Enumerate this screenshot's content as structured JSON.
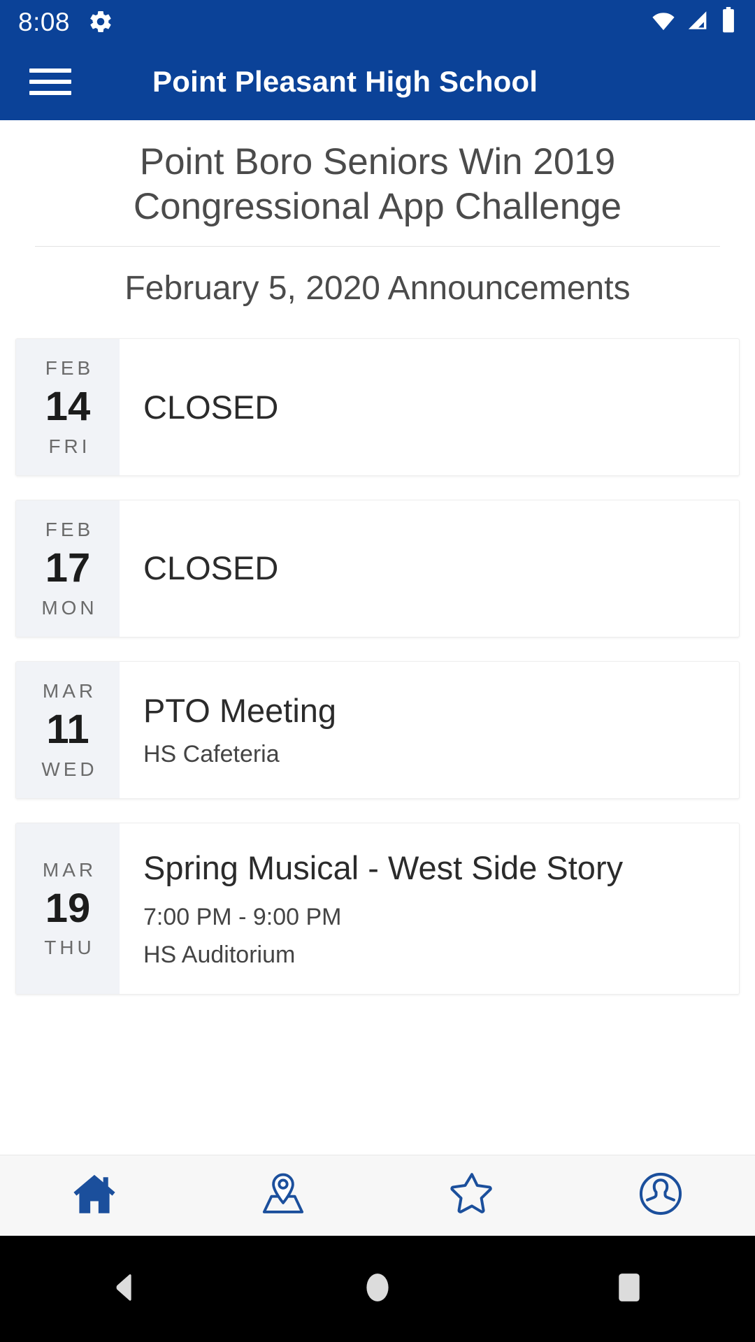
{
  "status_bar": {
    "time": "8:08",
    "icons": [
      "gear-icon",
      "wifi-icon",
      "cellular-signal-icon",
      "battery-icon"
    ]
  },
  "app_bar": {
    "menu_icon": "hamburger-menu-icon",
    "title": "Point Pleasant High School",
    "background_color": "#0b4298"
  },
  "main": {
    "headline": "Point Boro Seniors Win 2019 Congressional App Challenge",
    "section_title": "February 5, 2020 Announcements",
    "events": [
      {
        "month": "FEB",
        "day": "14",
        "weekday": "FRI",
        "title": "CLOSED",
        "time": "",
        "location": ""
      },
      {
        "month": "FEB",
        "day": "17",
        "weekday": "MON",
        "title": "CLOSED",
        "time": "",
        "location": ""
      },
      {
        "month": "MAR",
        "day": "11",
        "weekday": "WED",
        "title": "PTO Meeting",
        "time": "",
        "location": "HS Cafeteria"
      },
      {
        "month": "MAR",
        "day": "19",
        "weekday": "THU",
        "title": "Spring Musical - West Side Story",
        "time": "7:00 PM - 9:00 PM",
        "location": "HS Auditorium"
      }
    ]
  },
  "tab_bar": {
    "accent_color": "#1b4f9c",
    "items": [
      {
        "name": "home",
        "icon": "home-icon",
        "selected": true
      },
      {
        "name": "map",
        "icon": "map-pin-icon",
        "selected": false
      },
      {
        "name": "favorites",
        "icon": "star-icon",
        "selected": false
      },
      {
        "name": "profile",
        "icon": "person-icon",
        "selected": false
      }
    ]
  },
  "nav_bar": {
    "buttons": [
      {
        "name": "back",
        "icon": "triangle-back-icon"
      },
      {
        "name": "home",
        "icon": "circle-home-icon"
      },
      {
        "name": "recents",
        "icon": "square-recents-icon"
      }
    ]
  }
}
